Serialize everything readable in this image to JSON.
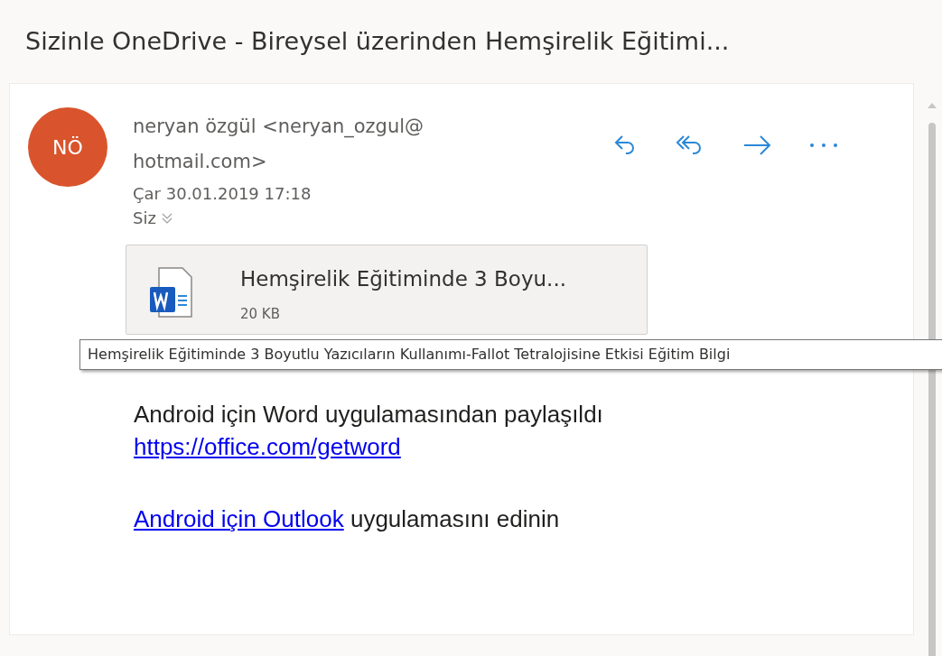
{
  "subject": "Sizinle OneDrive - Bireysel üzerinden Hemşirelik Eğitimi...",
  "sender": {
    "initials": "NÖ",
    "color": "#d9542c",
    "name_line": "neryan özgül <neryan_ozgul@",
    "name_line_2": "hotmail.com>",
    "date": "Çar 30.01.2019 17:18",
    "to": "Siz"
  },
  "attachment": {
    "name": "Hemşirelik Eğitiminde 3 Boyu...",
    "size": "20 KB"
  },
  "tooltip": "Hemşirelik Eğitiminde 3 Boyutlu Yazıcıların Kullanımı-Fallot Tetralojisine Etkisi Eğitim Bilgi",
  "body": [
    {
      "kind": "text",
      "text": "Android için Word uygulamasından paylaşıldı"
    },
    {
      "kind": "link",
      "text": "https://office.com/getword"
    },
    {
      "kind": "gap"
    },
    {
      "kind": "mixed",
      "link": "Android için Outlook",
      "text": "uygulamasını edinin"
    }
  ]
}
